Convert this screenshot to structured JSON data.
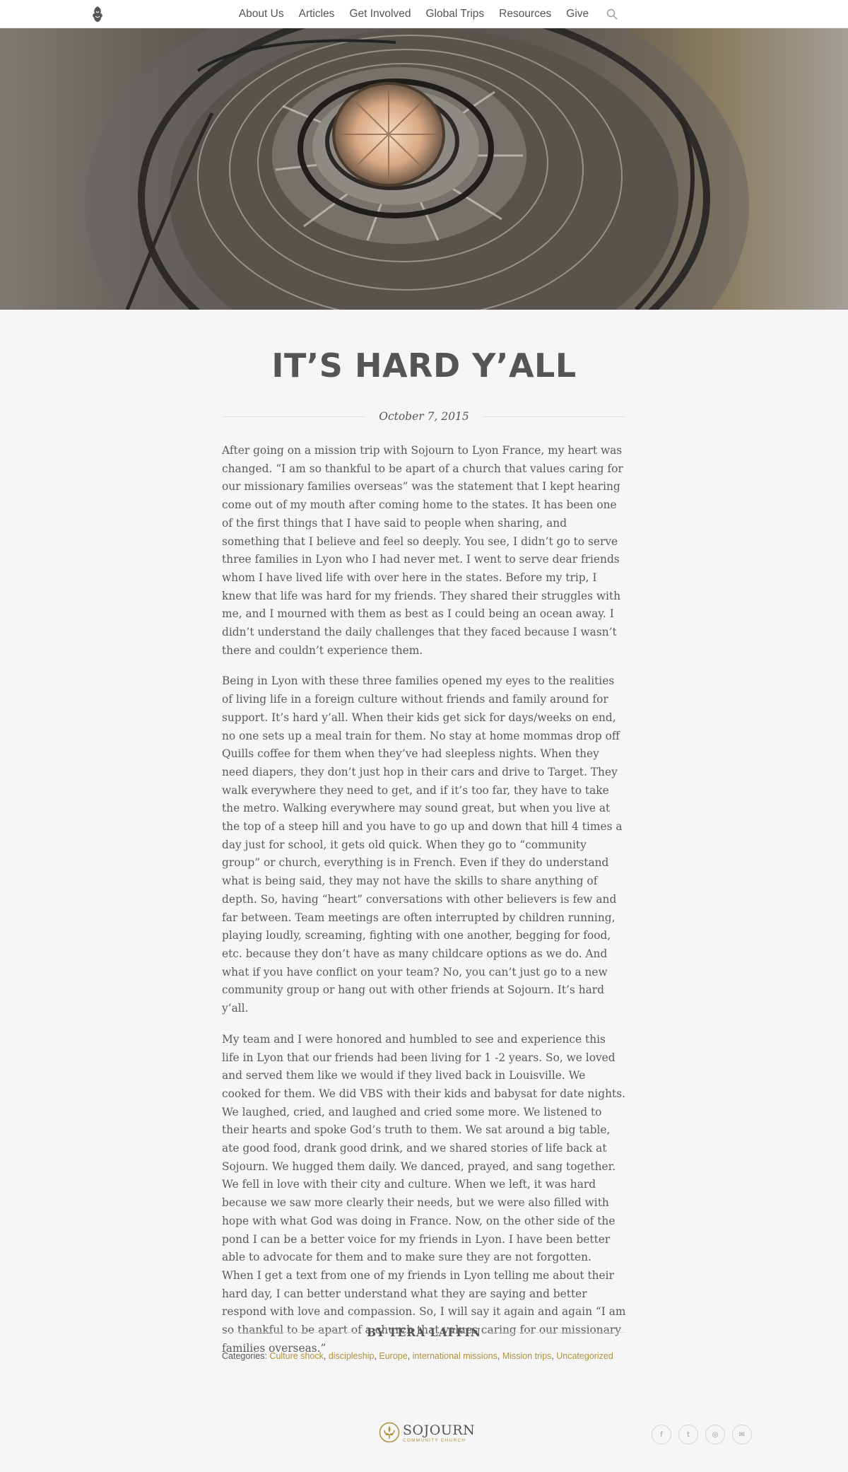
{
  "nav": {
    "logo_label": "Sojourn",
    "links": [
      {
        "label": "About Us"
      },
      {
        "label": "Articles"
      },
      {
        "label": "Get Involved"
      },
      {
        "label": "Global Trips"
      },
      {
        "label": "Resources"
      },
      {
        "label": "Give"
      }
    ],
    "search_icon": "search-icon"
  },
  "hero": {
    "image_subject": "spiral staircase viewed from below"
  },
  "article": {
    "title": "IT’S HARD Y’ALL",
    "date": "October 7, 2015",
    "paragraphs": [
      "After going on a mission trip with Sojourn to Lyon France, my heart was changed.  “I am so thankful to be apart of a church that values caring for our missionary families overseas” was the statement that I kept hearing come out of my mouth after coming home to the states.  It has been one of the first things that I have said to people when sharing, and something that I believe and feel so deeply.  You see, I didn’t go to serve three families in Lyon who I had never met.  I went to serve dear friends whom I have lived life with over here in the states.  Before my trip, I knew that life was hard for my friends.  They shared their struggles with me, and I mourned with them as best as I could being an ocean away. I didn’t understand the daily challenges that they faced because I wasn’t there and couldn’t experience them.",
      "Being in Lyon with these three families opened my eyes to the realities of living life in a foreign culture without friends and family around for support.  It’s hard y’all.  When their kids get sick for days/weeks on end, no one sets up a meal train for them.  No stay at home mommas drop off Quills coffee for them when they’ve had sleepless nights. When they need diapers, they don’t just hop in their cars and drive to Target.  They walk everywhere they need to get, and if it’s too far, they have to take the metro. Walking everywhere may sound great, but when you live at the top of a steep hill and you have to go up and down that hill 4 times a day just for school, it gets old quick.  When they go to “community group” or church, everything is in French. Even if they do understand what is being said, they may not have the skills to share anything of depth. So, having “heart” conversations with other believers is few and far between. Team meetings are often interrupted by children running, playing loudly, screaming, fighting with one another, begging for food, etc. because they don’t have as many childcare options as we do.   And what if you have conflict on your team?  No, you can’t just go to a new community group or hang out with other friends at Sojourn.  It’s hard y’all.",
      "My team and I were honored and humbled to see and experience this life in Lyon that our friends had been living for 1 -2 years.  So, we loved and served them like we would if they lived back in Louisville.  We cooked for them. We did VBS with their kids and babysat for date nights. We laughed, cried, and laughed and cried some more. We listened to their hearts and spoke God’s truth to them. We sat around a big table, ate good food, drank good drink, and we shared stories of life back at Sojourn. We hugged them daily. We danced, prayed, and sang together. We fell in love with their city and culture.  When we left, it was hard because we saw more clearly their needs, but we were also filled with hope with what God was doing in France.  Now, on the other side of the pond I can be a better voice for my friends in Lyon.  I have been better able to advocate for them and to make sure they are not forgotten.  When I get a text from one of my friends in Lyon telling me about their hard day, I can better understand what they are saying and better respond with love and compassion.  So, I will say it again and again “I am so thankful to be apart of a church that values caring for our missionary families overseas.”"
    ],
    "byline_prefix": "BY",
    "author": "TERA LAFFIN",
    "categories_label": "Categories:",
    "categories": [
      "Culture shock",
      "discipleship",
      "Europe",
      "international missions",
      "Mission trips",
      "Uncategorized"
    ]
  },
  "footer": {
    "brand": "SOJOURN",
    "brand_sub": "COMMUNITY CHURCH",
    "social": [
      {
        "icon": "facebook-icon",
        "glyph": "f"
      },
      {
        "icon": "twitter-icon",
        "glyph": "t"
      },
      {
        "icon": "instagram-icon",
        "glyph": "◎"
      },
      {
        "icon": "email-icon",
        "glyph": "✉"
      }
    ]
  },
  "colors": {
    "background": "#f6f6f6",
    "text": "#555555",
    "accent": "#b0903e",
    "rule": "#dedede"
  }
}
